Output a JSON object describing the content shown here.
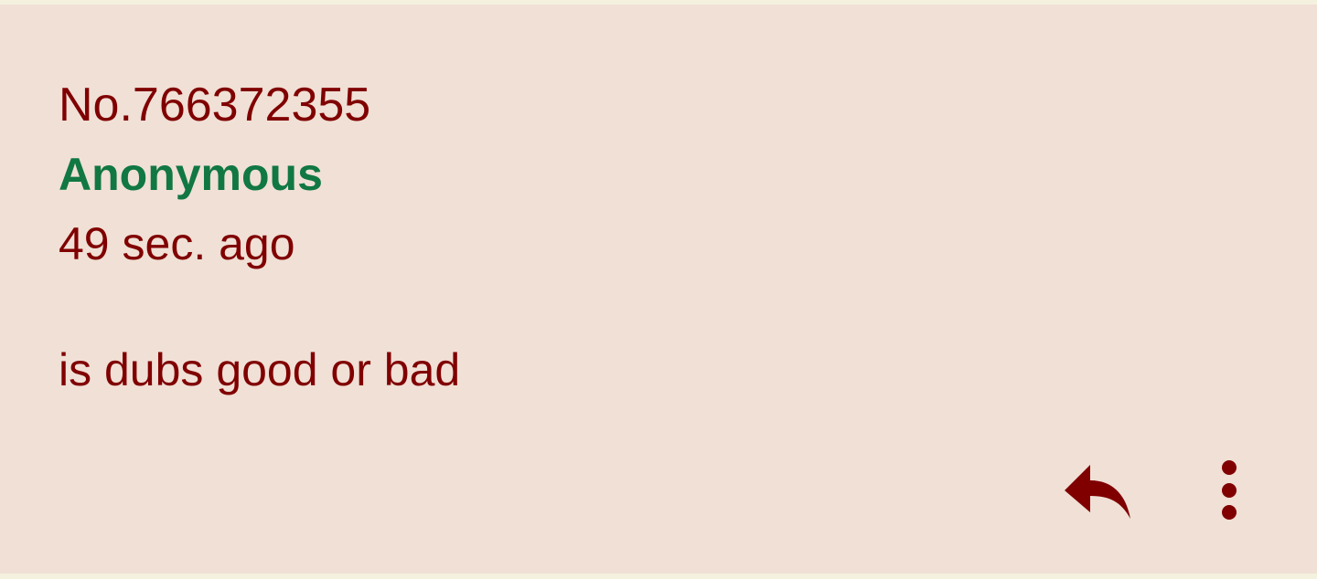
{
  "post": {
    "number": "No.766372355",
    "name": "Anonymous",
    "time": "49 sec. ago",
    "comment": "is dubs good or bad"
  },
  "actions": {
    "reply_icon": "reply-icon",
    "more_icon": "more-vertical-icon"
  },
  "colors": {
    "background": "#f0e0d6",
    "text": "#800000",
    "name": "#117743",
    "outer": "#f5f1df"
  }
}
